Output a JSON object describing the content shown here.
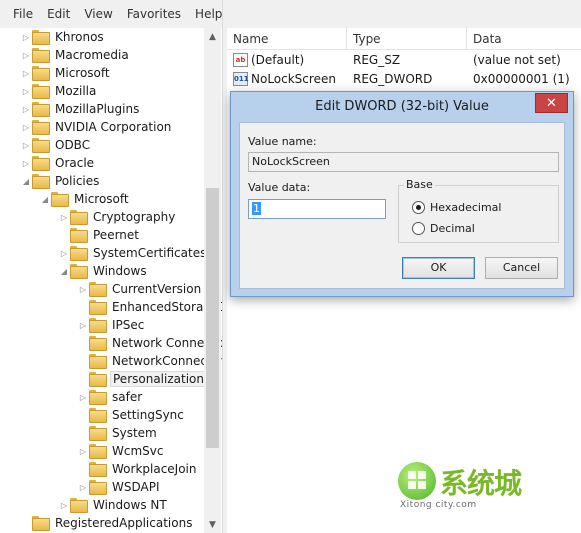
{
  "menubar": {
    "items": [
      "File",
      "Edit",
      "View",
      "Favorites",
      "Help"
    ]
  },
  "tree": {
    "items": [
      {
        "label": "Khronos",
        "expander": "collapsed"
      },
      {
        "label": "Macromedia",
        "expander": "collapsed"
      },
      {
        "label": "Microsoft",
        "expander": "collapsed"
      },
      {
        "label": "Mozilla",
        "expander": "collapsed"
      },
      {
        "label": "MozillaPlugins",
        "expander": "collapsed"
      },
      {
        "label": "NVIDIA Corporation",
        "expander": "collapsed"
      },
      {
        "label": "ODBC",
        "expander": "collapsed"
      },
      {
        "label": "Oracle",
        "expander": "collapsed"
      },
      {
        "label": "Policies",
        "expander": "expanded"
      },
      {
        "label": "Microsoft",
        "expander": "expanded"
      },
      {
        "label": "Cryptography",
        "expander": "collapsed"
      },
      {
        "label": "Peernet",
        "expander": "none"
      },
      {
        "label": "SystemCertificates",
        "expander": "collapsed"
      },
      {
        "label": "Windows",
        "expander": "expanded"
      },
      {
        "label": "CurrentVersion",
        "expander": "collapsed"
      },
      {
        "label": "EnhancedStorageDevices",
        "expander": "none"
      },
      {
        "label": "IPSec",
        "expander": "collapsed"
      },
      {
        "label": "Network Connections",
        "expander": "none"
      },
      {
        "label": "NetworkConnectivityStatusIndicator",
        "expander": "none"
      },
      {
        "label": "Personalization",
        "expander": "none",
        "selected": true
      },
      {
        "label": "safer",
        "expander": "collapsed"
      },
      {
        "label": "SettingSync",
        "expander": "none"
      },
      {
        "label": "System",
        "expander": "none"
      },
      {
        "label": "WcmSvc",
        "expander": "collapsed"
      },
      {
        "label": "WorkplaceJoin",
        "expander": "none"
      },
      {
        "label": "WSDAPI",
        "expander": "collapsed"
      },
      {
        "label": "Windows NT",
        "expander": "collapsed"
      },
      {
        "label": "RegisteredApplications",
        "expander": "none"
      }
    ]
  },
  "list": {
    "columns": [
      "Name",
      "Type",
      "Data"
    ],
    "rows": [
      {
        "icon": "string-value-icon",
        "icon_text": "ab",
        "name": "(Default)",
        "type": "REG_SZ",
        "data": "(value not set)"
      },
      {
        "icon": "dword-value-icon",
        "icon_text": "011",
        "name": "NoLockScreen",
        "type": "REG_DWORD",
        "data": "0x00000001 (1)"
      }
    ]
  },
  "dialog": {
    "title": "Edit DWORD (32-bit) Value",
    "close_glyph": "✕",
    "value_name_label": "Value name:",
    "value_name": "NoLockScreen",
    "value_data_label": "Value data:",
    "value_data": "1",
    "base_label": "Base",
    "hex_label": "Hexadecimal",
    "dec_label": "Decimal",
    "selected_base": "Hexadecimal",
    "ok_label": "OK",
    "cancel_label": "Cancel"
  },
  "watermark": {
    "text": "系统城",
    "sub": "Xitong city.com"
  },
  "colors": {
    "dialog_frame": "#b7d0ec",
    "close_button": "#c74545",
    "selection": "#3399ff",
    "watermark": "#79b928"
  }
}
